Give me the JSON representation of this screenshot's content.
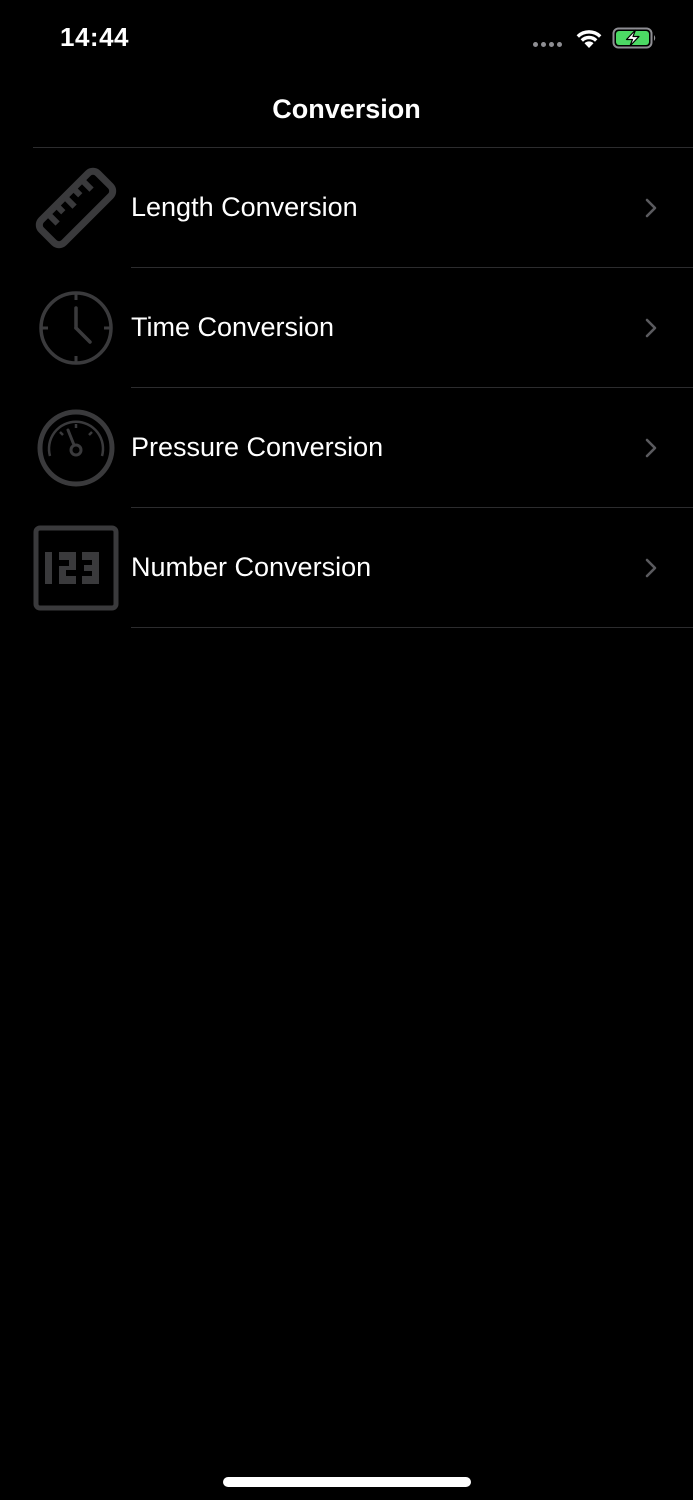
{
  "status_bar": {
    "time": "14:44",
    "battery_color": "#4cd964"
  },
  "nav": {
    "title": "Conversion"
  },
  "rows": [
    {
      "label": "Length Conversion",
      "icon": "ruler-icon"
    },
    {
      "label": "Time Conversion",
      "icon": "clock-icon"
    },
    {
      "label": "Pressure Conversion",
      "icon": "gauge-icon"
    },
    {
      "label": "Number Conversion",
      "icon": "number-123-icon"
    }
  ]
}
